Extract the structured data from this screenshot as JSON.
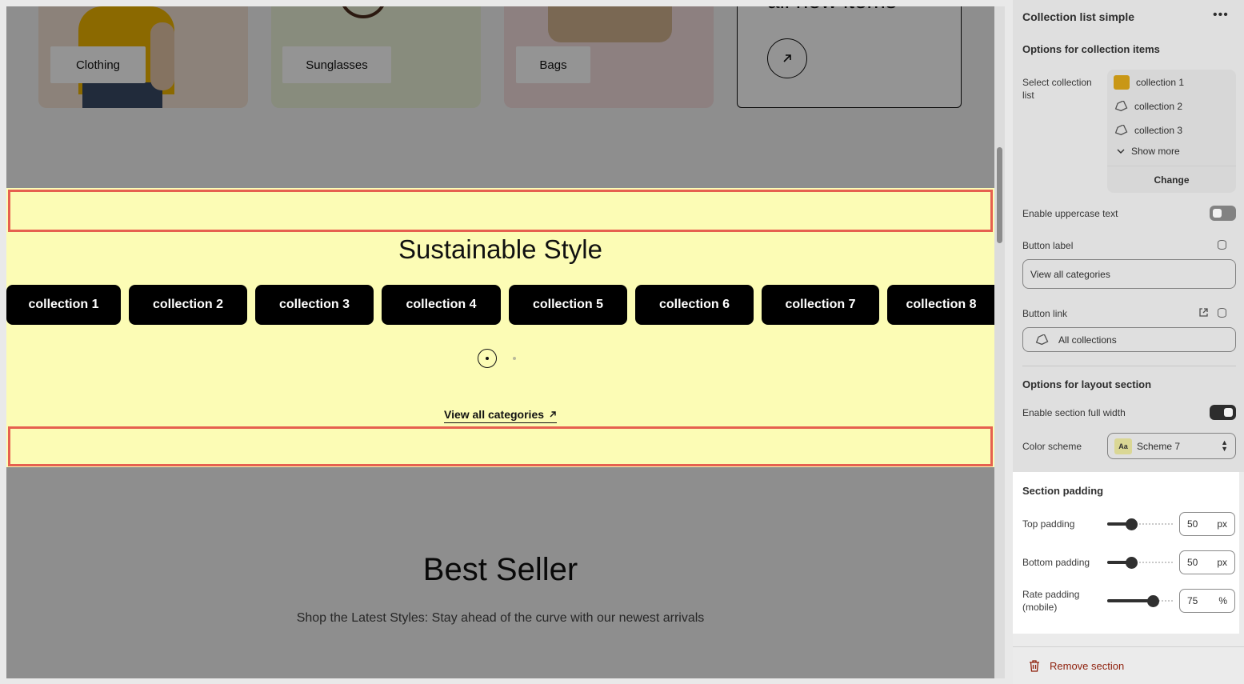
{
  "preview": {
    "cards": [
      {
        "label": "Clothing"
      },
      {
        "label": "Sunglasses"
      },
      {
        "label": "Bags"
      }
    ],
    "new_items_heading": "all new items",
    "section": {
      "title": "Sustainable Style",
      "collections": [
        "collection 1",
        "collection 2",
        "collection 3",
        "collection 4",
        "collection 5",
        "collection 6",
        "collection 7",
        "collection 8"
      ],
      "view_all_label": "View all categories",
      "pad_color": "#fcfcb5",
      "highlight_color": "#e6604f"
    },
    "best_seller": {
      "title": "Best Seller",
      "subtitle": "Shop the Latest Styles: Stay ahead of the curve with our newest arrivals"
    }
  },
  "panel": {
    "title": "Collection list simple",
    "more_icon": "more-horizontal-icon",
    "collection_items_heading": "Options for collection items",
    "select_collection_label": "Select collection list",
    "selected_collections": [
      "collection 1",
      "collection 2",
      "collection 3"
    ],
    "show_more_label": "Show more",
    "change_label": "Change",
    "uppercase_label": "Enable uppercase text",
    "uppercase_enabled": false,
    "button_label_label": "Button label",
    "button_label_value": "View all categories",
    "button_link_label": "Button link",
    "button_link_value": "All collections",
    "layout_heading": "Options for layout section",
    "full_width_label": "Enable section full width",
    "full_width_enabled": true,
    "color_scheme_label": "Color scheme",
    "color_scheme_value": "Scheme 7",
    "color_scheme_swatch": "Aa",
    "padding": {
      "heading": "Section padding",
      "top_label": "Top padding",
      "top_value": "50",
      "top_unit": "px",
      "top_fraction": 0.36,
      "bottom_label": "Bottom padding",
      "bottom_value": "50",
      "bottom_unit": "px",
      "bottom_fraction": 0.36,
      "rate_label": "Rate padding (mobile)",
      "rate_value": "75",
      "rate_unit": "%",
      "rate_fraction": 0.7
    },
    "remove_label": "Remove section"
  }
}
